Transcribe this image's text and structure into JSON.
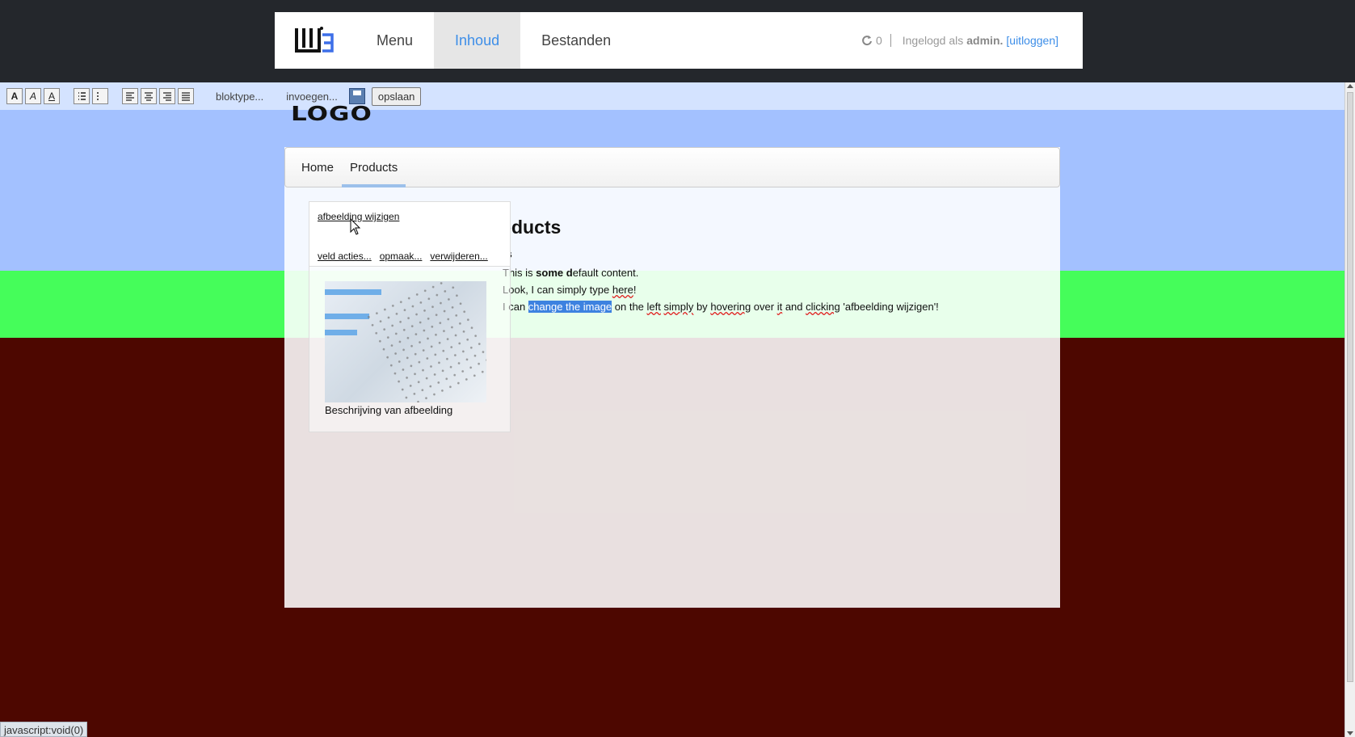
{
  "admin": {
    "logo_alt": "W3 logo",
    "nav": [
      {
        "label": "Menu",
        "active": false
      },
      {
        "label": "Inhoud",
        "active": true
      },
      {
        "label": "Bestanden",
        "active": false
      }
    ],
    "sync_count": "0",
    "logged_in_prefix": "Ingelogd als",
    "username": "admin.",
    "logout_label": "uitloggen",
    "bracket_open": "[",
    "bracket_close": "]"
  },
  "toolbar": {
    "format_buttons": [
      "A",
      "A",
      "A"
    ],
    "blocktype_label": "bloktype...",
    "insert_label": "invoegen...",
    "save_label": "opslaan"
  },
  "site": {
    "logo_text": "LOGO",
    "nav": [
      {
        "label": "Home",
        "active": false
      },
      {
        "label": "Products",
        "active": true
      }
    ]
  },
  "content": {
    "title": "roducts",
    "subtitle": "s",
    "p1_a": "This is ",
    "p1_b": "some d",
    "p1_c": "efault content.",
    "p2_a": "Look, I can simply type ",
    "p2_b": "here",
    "p2_c": "!",
    "p3_a": "I can ",
    "p3_hl": "change the image",
    "p3_b": " on the ",
    "p3_left": "left",
    "p3_c": " ",
    "p3_simply": "simply",
    "p3_d": " by ",
    "p3_hovering": "hovering",
    "p3_e": " over ",
    "p3_it": "it",
    "p3_f": " and ",
    "p3_clicking": "clicking",
    "p3_g": " 'afbeelding wijzigen'!"
  },
  "image_field": {
    "change_label": "afbeelding wijzigen",
    "actions": [
      "veld acties...",
      "opmaak...",
      "verwijderen..."
    ],
    "caption": "Beschrijving van afbeelding"
  },
  "status_bar": {
    "text": "javascript:void(0)"
  },
  "colors": {
    "accent": "#3d8ee8",
    "highlight": "#3d82e0",
    "band_blue": "#a3c1ff",
    "band_green": "#45fd5a",
    "bg_dark": "#4d0700"
  }
}
